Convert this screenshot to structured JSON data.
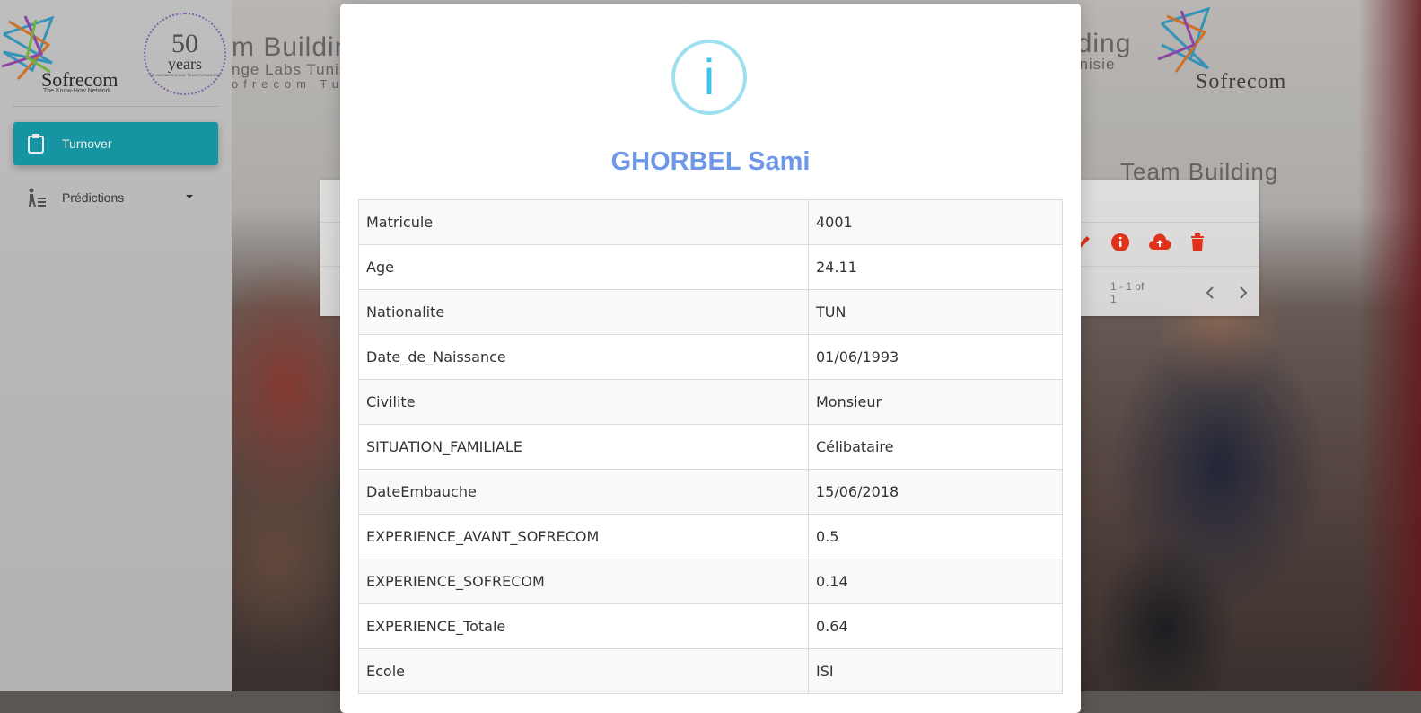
{
  "brand": {
    "name": "Sofrecom",
    "tagline": "The Know-How Network",
    "badge_number": "50",
    "badge_word": "years",
    "badge_sub": "OF INNOVATION AND TRANSFORMATION"
  },
  "sidebar": {
    "items": [
      {
        "label": "Turnover",
        "icon": "clipboard-icon",
        "active": true
      },
      {
        "label": "Prédictions",
        "icon": "person-chart-icon",
        "active": false,
        "expandable": true
      }
    ]
  },
  "background": {
    "banner_texts": [
      "m Building",
      "nge Labs Tunis",
      "ofrecom Tunis",
      "lding",
      "unisie",
      "Team Building",
      "Sofrecom"
    ]
  },
  "table_card": {
    "pager_label": "1 - 1 of 1",
    "row_actions": [
      "edit-icon",
      "info-icon",
      "upload-icon",
      "delete-icon"
    ],
    "action_color": "#e0321a"
  },
  "modal": {
    "title": "GHORBEL Sami",
    "icon": "info-icon",
    "icon_glyph": "i",
    "title_color": "#6e97e8",
    "rows": [
      {
        "key": "Matricule",
        "value": "4001"
      },
      {
        "key": "Age",
        "value": "24.11"
      },
      {
        "key": "Nationalite",
        "value": "TUN"
      },
      {
        "key": "Date_de_Naissance",
        "value": "01/06/1993"
      },
      {
        "key": "Civilite",
        "value": "Monsieur"
      },
      {
        "key": "SITUATION_FAMILIALE",
        "value": "Célibataire"
      },
      {
        "key": "DateEmbauche",
        "value": "15/06/2018"
      },
      {
        "key": "EXPERIENCE_AVANT_SOFRECOM",
        "value": "0.5"
      },
      {
        "key": "EXPERIENCE_SOFRECOM",
        "value": "0.14"
      },
      {
        "key": "EXPERIENCE_Totale",
        "value": "0.64"
      },
      {
        "key": "Ecole",
        "value": "ISI"
      }
    ]
  },
  "colors": {
    "accent": "#17a2b0",
    "info": "#3fc3ee"
  }
}
